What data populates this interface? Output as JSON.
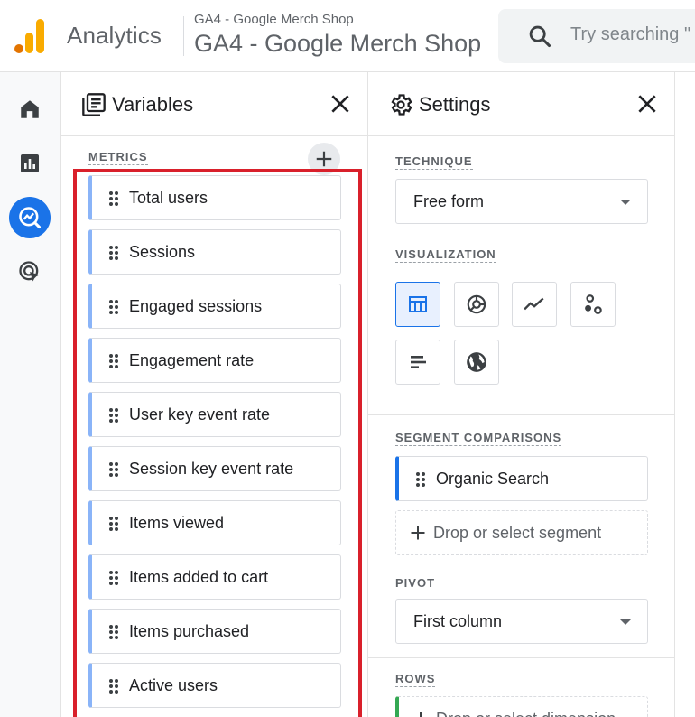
{
  "header": {
    "app_name": "Analytics",
    "account_small": "GA4 - Google Merch Shop",
    "account_big": "GA4 - Google Merch Shop",
    "search_placeholder": "Try searching \"",
    "logo_colors": [
      "#f9ab00",
      "#e37400"
    ]
  },
  "leftnav": {
    "items": [
      {
        "icon": "home-icon",
        "active": false
      },
      {
        "icon": "reports-icon",
        "active": false
      },
      {
        "icon": "explore-icon",
        "active": true
      },
      {
        "icon": "advertising-icon",
        "active": false
      }
    ],
    "accent": "#1a73e8"
  },
  "variables": {
    "title": "Variables",
    "metrics_label": "METRICS",
    "metrics": [
      "Total users",
      "Sessions",
      "Engaged sessions",
      "Engagement rate",
      "User key event rate",
      "Session key event rate",
      "Items viewed",
      "Items added to cart",
      "Items purchased",
      "Active users"
    ],
    "highlight_color": "#d9202b"
  },
  "settings": {
    "title": "Settings",
    "technique_label": "TECHNIQUE",
    "technique_value": "Free form",
    "visualization_label": "VISUALIZATION",
    "visualizations": [
      "table-icon",
      "donut-chart-icon",
      "line-chart-icon",
      "scatter-plot-icon",
      "bar-chart-icon",
      "geo-map-icon"
    ],
    "selected_visualization": "table-icon",
    "segment_label": "SEGMENT COMPARISONS",
    "segment_value": "Organic Search",
    "segment_drop": "Drop or select segment",
    "pivot_label": "PIVOT",
    "pivot_value": "First column",
    "rows_label": "ROWS",
    "rows_drop": "Drop or select dimension"
  }
}
